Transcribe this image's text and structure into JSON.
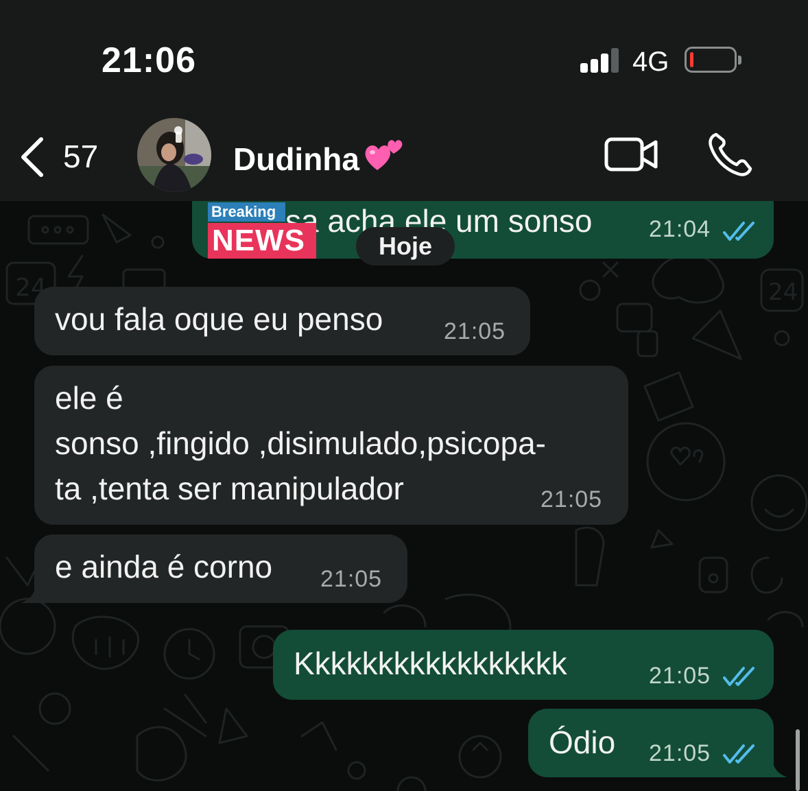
{
  "status_bar": {
    "time": "21:06",
    "network": "4G",
    "signal_bars": 3,
    "battery_level": 0.08,
    "battery_color": "#ff3b30"
  },
  "header": {
    "back_count": "57",
    "contact_name": "Dudinha"
  },
  "chat": {
    "day_label": "Hoje",
    "sticker": {
      "top": "Breaking",
      "bottom": "NEWS"
    },
    "messages": [
      {
        "direction": "out",
        "text": "sa acha ele um sonso",
        "time": "21:04",
        "read": true
      },
      {
        "direction": "in",
        "text": "vou fala oque eu penso",
        "time": "21:05"
      },
      {
        "direction": "in",
        "lines": [
          "ele é",
          "sonso ,fingido ,disimulado,psicopa-",
          "ta ,tenta ser manipulador"
        ],
        "time": "21:05"
      },
      {
        "direction": "in",
        "text": "e ainda é corno",
        "time": "21:05"
      },
      {
        "direction": "out",
        "text": "Kkkkkkkkkkkkkkkkk",
        "time": "21:05",
        "read": true
      },
      {
        "direction": "out",
        "text": "Ódio",
        "time": "21:05",
        "read": true
      }
    ]
  },
  "colors": {
    "incoming_bubble": "#232626",
    "outgoing_bubble": "#134d37",
    "read_ticks": "#53bdeb",
    "header_bg": "#181a1a"
  }
}
